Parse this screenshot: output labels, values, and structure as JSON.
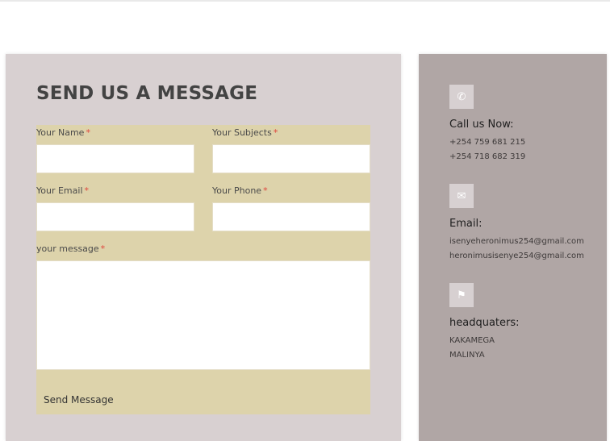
{
  "form": {
    "title": "SEND US A MESSAGE",
    "required_mark": "*",
    "fields": {
      "name": {
        "label": "Your Name",
        "value": ""
      },
      "subjects": {
        "label": "Your Subjects",
        "value": ""
      },
      "email": {
        "label": "Your Email",
        "value": ""
      },
      "phone": {
        "label": "Your Phone",
        "value": ""
      },
      "message": {
        "label": "your message",
        "value": ""
      }
    },
    "submit_label": "Send Message"
  },
  "contact": {
    "call": {
      "icon": "phone-icon",
      "heading": "Call us Now:",
      "lines": [
        "+254 759 681 215",
        "+254 718 682 319"
      ]
    },
    "email": {
      "icon": "email-icon",
      "heading": "Email:",
      "lines": [
        "isenyeheronimus254@gmail.com",
        "heronimusisenye254@gmail.com"
      ]
    },
    "hq": {
      "icon": "location-icon",
      "heading": "headquaters:",
      "lines": [
        "KAKAMEGA",
        "MALINYA"
      ]
    }
  },
  "colors": {
    "form_panel": "#d8d0d1",
    "form_area": "#ddd3ab",
    "info_panel": "#b0a6a5",
    "required": "#e0473e"
  }
}
